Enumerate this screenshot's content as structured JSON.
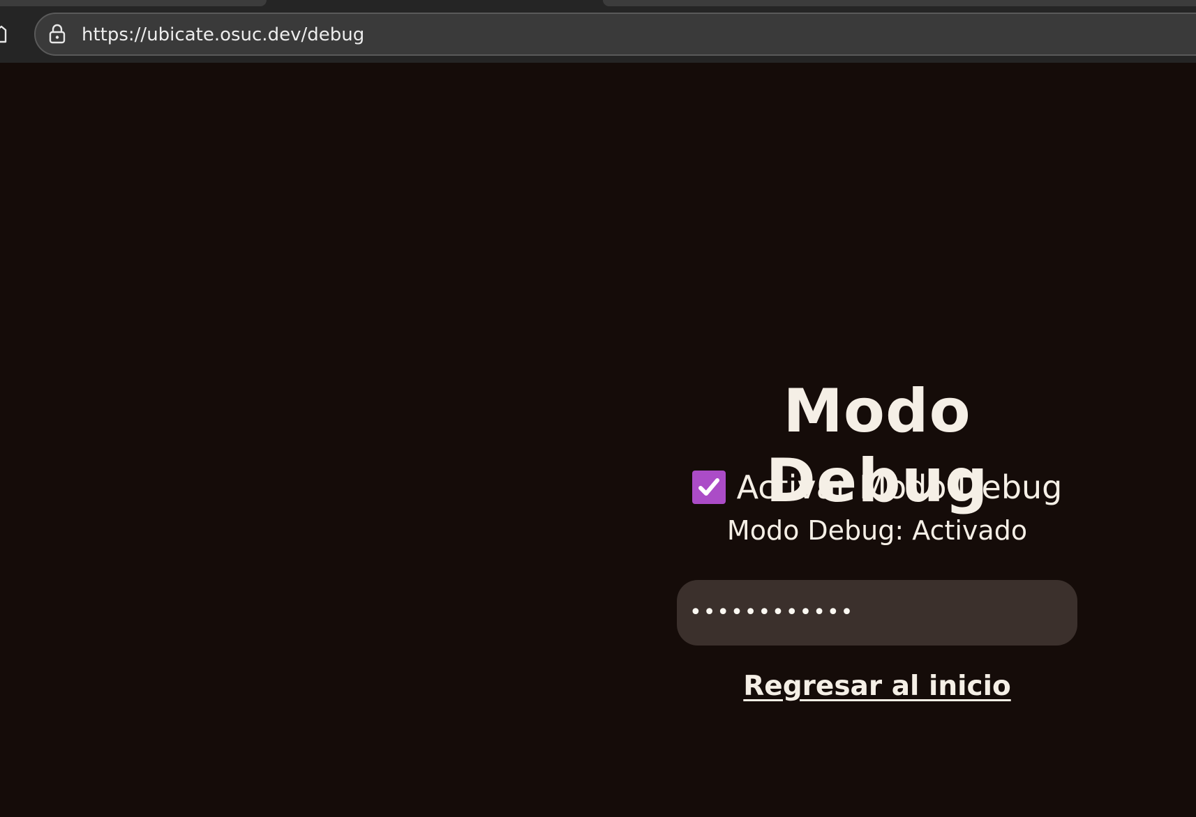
{
  "browser": {
    "url": "https://ubicate.osuc.dev/debug"
  },
  "page": {
    "title": "Modo Debug",
    "checkbox_label": "Activar Modo Debug",
    "checkbox_checked": true,
    "status_text": "Modo Debug: Activado",
    "password_mask": "••••••••••••",
    "back_link": "Regresar al inicio"
  },
  "colors": {
    "background": "#150c09",
    "text": "#f5efe6",
    "checkbox_accent": "#ab4cc7",
    "input_background": "#3b302c"
  },
  "icons": {
    "home": "home-icon",
    "lock": "lock-icon",
    "check": "checkmark-icon"
  }
}
